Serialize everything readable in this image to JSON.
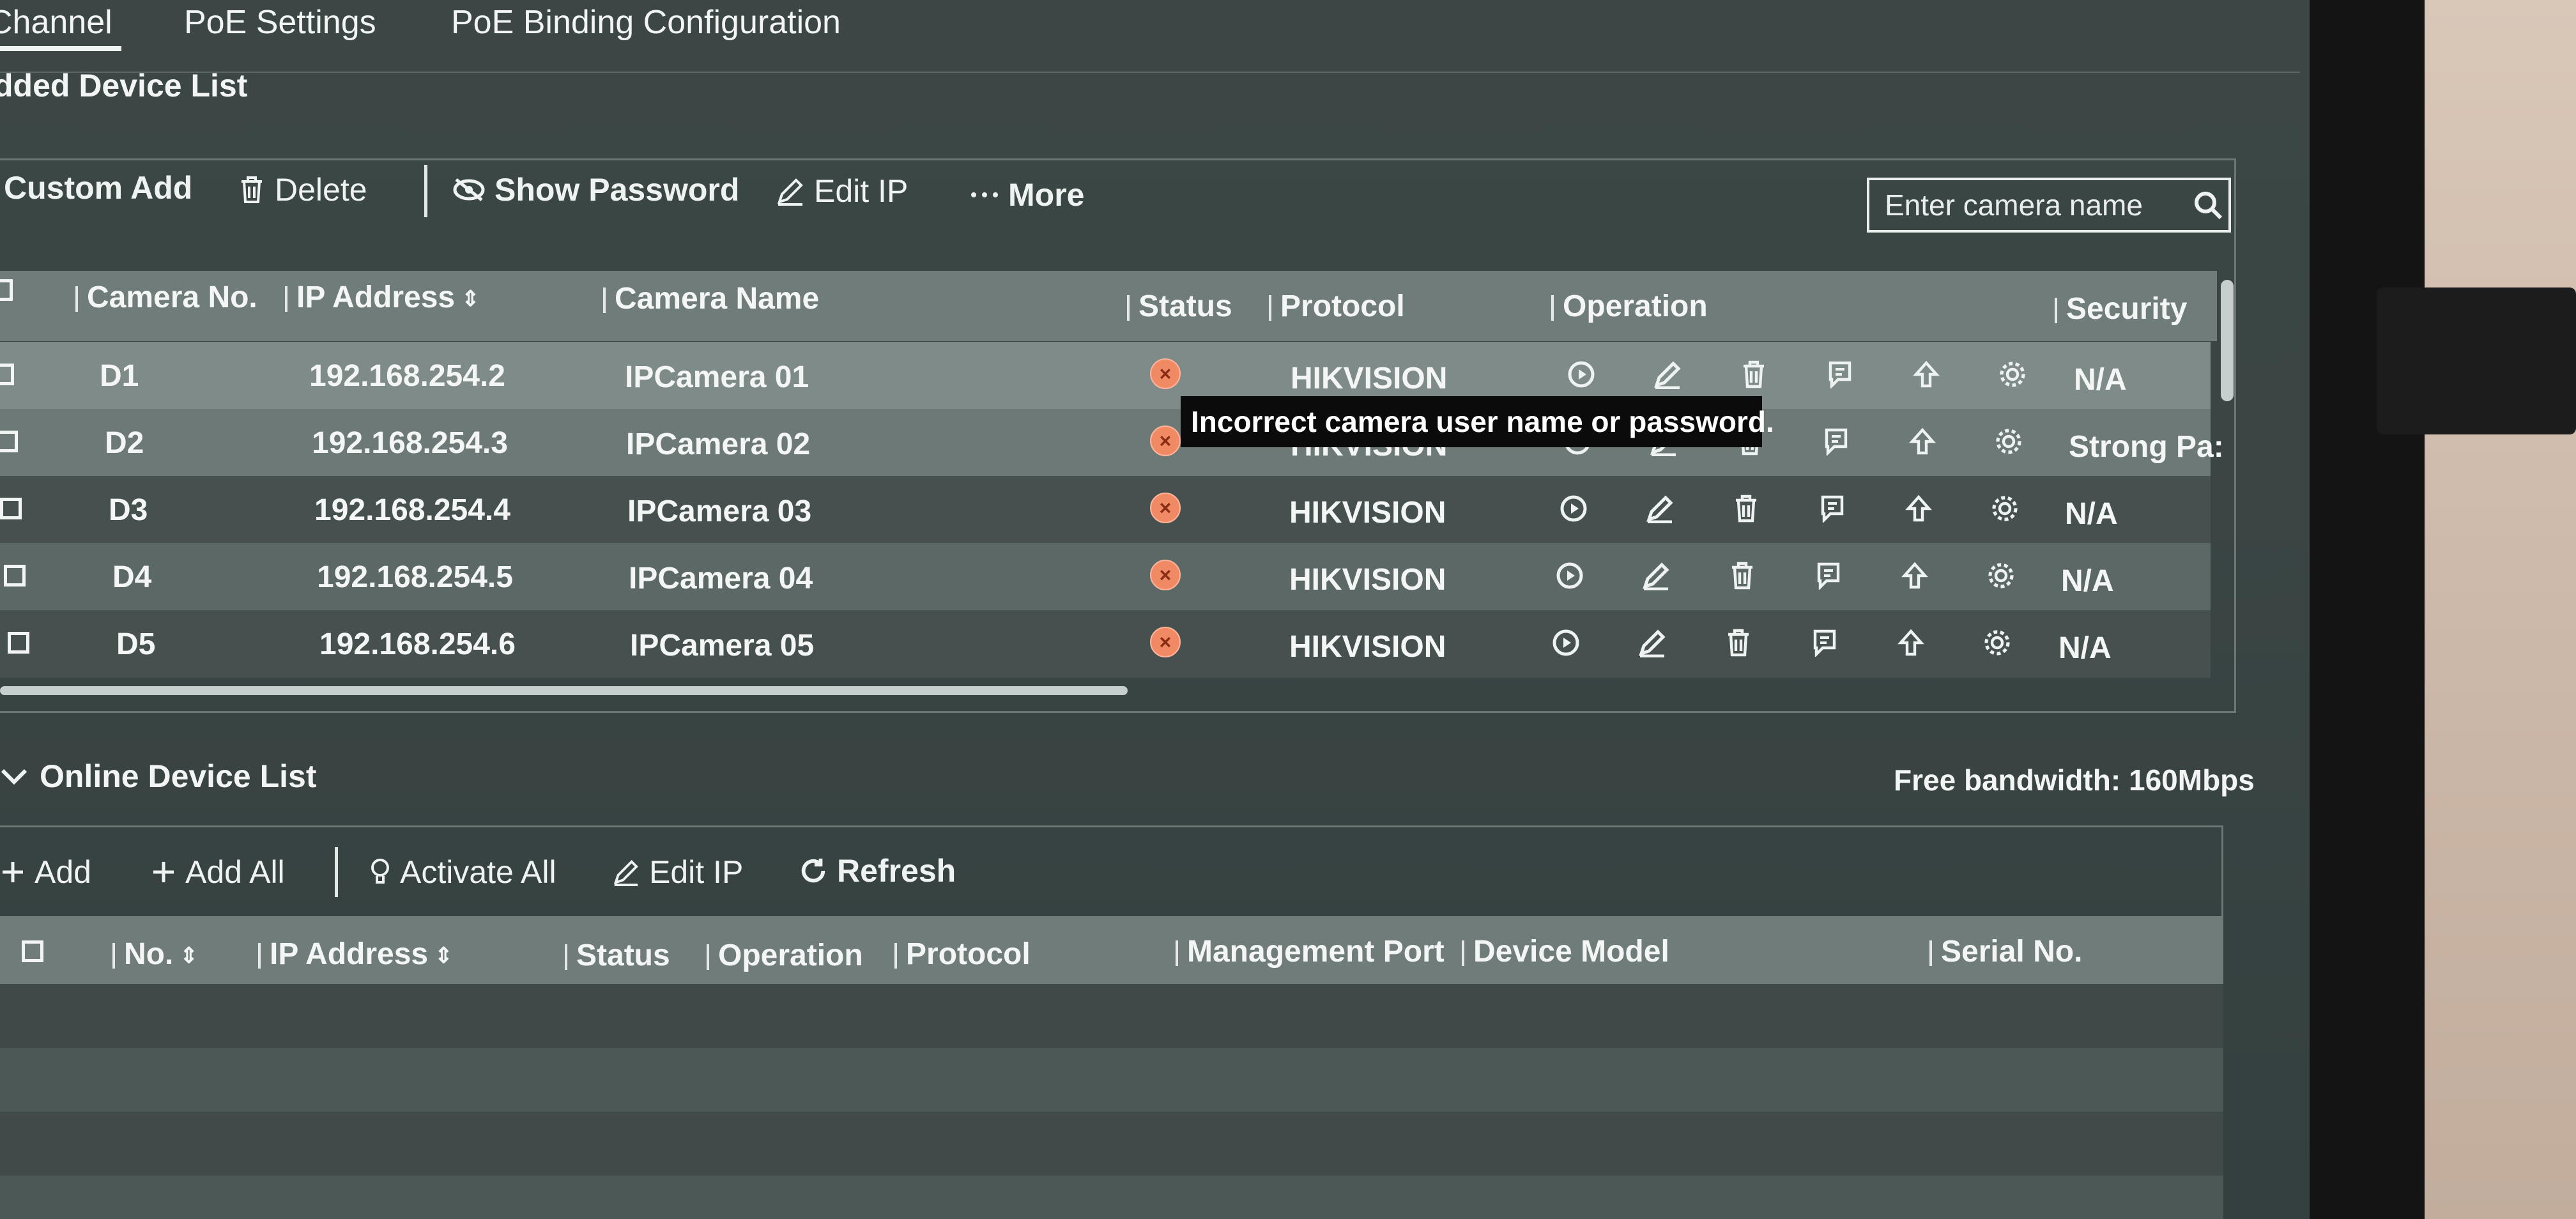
{
  "tabs": [
    "Channel",
    "PoE Settings",
    "PoE Binding Configuration"
  ],
  "added_list": {
    "title": "dded Device List",
    "toolbar": {
      "custom_add": "Custom Add",
      "delete": "Delete",
      "show_password": "Show Password",
      "edit_ip": "Edit IP",
      "more": "More"
    },
    "search_placeholder": "Enter camera name",
    "columns": {
      "camera_no": "Camera No.",
      "ip": "IP Address",
      "name": "Camera Name",
      "status": "Status",
      "protocol": "Protocol",
      "operation": "Operation",
      "security": "Security"
    },
    "rows": [
      {
        "no": "D1",
        "ip": "192.168.254.2",
        "name": "IPCamera 01",
        "protocol": "HIKVISION",
        "security": "N/A"
      },
      {
        "no": "D2",
        "ip": "192.168.254.3",
        "name": "IPCamera 02",
        "protocol": "HIKVISION",
        "security": "Strong Pa:"
      },
      {
        "no": "D3",
        "ip": "192.168.254.4",
        "name": "IPCamera 03",
        "protocol": "HIKVISION",
        "security": "N/A"
      },
      {
        "no": "D4",
        "ip": "192.168.254.5",
        "name": "IPCamera 04",
        "protocol": "HIKVISION",
        "security": "N/A"
      },
      {
        "no": "D5",
        "ip": "192.168.254.6",
        "name": "IPCamera 05",
        "protocol": "HIKVISION",
        "security": "N/A"
      }
    ],
    "tooltip": "Incorrect camera user name or password."
  },
  "online_list": {
    "title": "Online Device List",
    "bandwidth": "Free bandwidth: 160Mbps",
    "toolbar": {
      "add": "Add",
      "add_all": "Add All",
      "activate_all": "Activate All",
      "edit_ip": "Edit IP",
      "refresh": "Refresh"
    },
    "columns": {
      "no": "No.",
      "ip": "IP Address",
      "status": "Status",
      "operation": "Operation",
      "protocol": "Protocol",
      "mgmt_port": "Management Port",
      "model": "Device Model",
      "serial": "Serial No."
    }
  },
  "icons": {
    "status_error": "error-circle-icon",
    "ops": [
      "play-icon",
      "edit-icon",
      "delete-icon",
      "details-icon",
      "upgrade-icon",
      "settings-icon"
    ]
  },
  "colors": {
    "status_error": "#f08a64",
    "header_row": "#6f7c7a",
    "row_light": "#7e8b88",
    "row_dark": "#46514f"
  }
}
